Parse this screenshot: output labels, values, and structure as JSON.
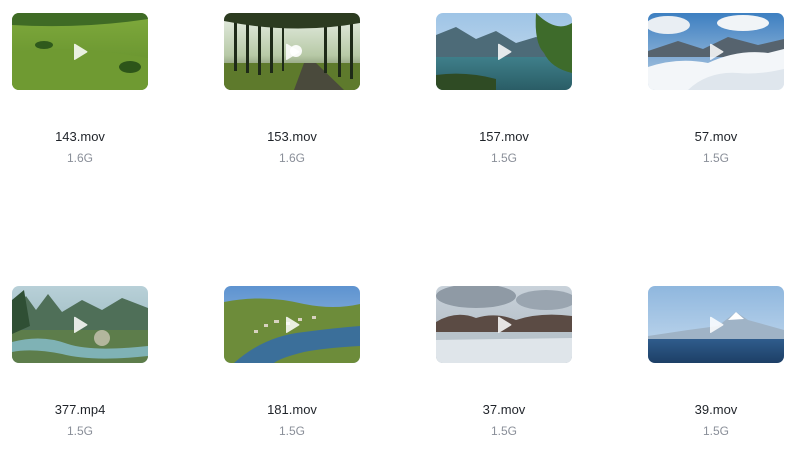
{
  "files": [
    {
      "name": "143.mov",
      "size": "1.6G",
      "scene": "green-meadow"
    },
    {
      "name": "153.mov",
      "size": "1.6G",
      "scene": "tree-lined-path"
    },
    {
      "name": "157.mov",
      "size": "1.5G",
      "scene": "mountain-lake"
    },
    {
      "name": "57.mov",
      "size": "1.5G",
      "scene": "snowy-mountains"
    },
    {
      "name": "377.mp4",
      "size": "1.5G",
      "scene": "karst-river"
    },
    {
      "name": "181.mov",
      "size": "1.5G",
      "scene": "river-valley-town"
    },
    {
      "name": "37.mov",
      "size": "1.5G",
      "scene": "cloudy-lake"
    },
    {
      "name": "39.mov",
      "size": "1.5G",
      "scene": "snow-peak-sea"
    }
  ],
  "play_icon": "play-icon"
}
